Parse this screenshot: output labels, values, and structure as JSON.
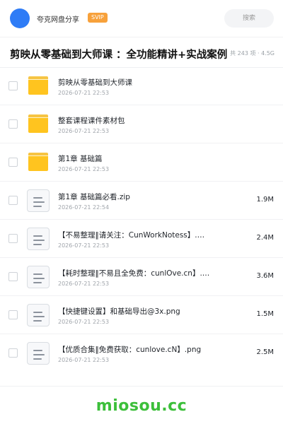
{
  "header": {
    "user_name": "夸克网盘分享",
    "badge": "SVIP",
    "search_label": "搜索"
  },
  "share": {
    "title": "剪映从零基础到大师课 ：全功能精讲+实战案例",
    "meta": "共 243 项 · 4.5G"
  },
  "files": [
    {
      "type": "folder",
      "name": "剪映从零基础到大师课",
      "date": "2026-07-21 22:53",
      "size": ""
    },
    {
      "type": "folder",
      "name": "整套课程课件素材包",
      "date": "2026-07-21 22:53",
      "size": ""
    },
    {
      "type": "folder",
      "name": "第1章 基础篇",
      "date": "2026-07-21 22:53",
      "size": ""
    },
    {
      "type": "file",
      "name": "第1章 基础篇必看.zip",
      "date": "2026-07-21 22:54",
      "size": "1.9M"
    },
    {
      "type": "file",
      "name": "【不易整理‖请关注：CunWorkNotess】.…",
      "date": "2026-07-21 22:53",
      "size": "2.4M"
    },
    {
      "type": "file",
      "name": "【耗时整理‖不易且全免费：cunlOve.cn】.…",
      "date": "2026-07-21 22:53",
      "size": "3.6M"
    },
    {
      "type": "file",
      "name": "【快捷键设置】和基础导出@3x.png",
      "date": "2026-07-21 22:53",
      "size": "1.5M"
    },
    {
      "type": "file",
      "name": "【优质合集‖免费获取：cunlove.cN】.png",
      "date": "2026-07-21 22:53",
      "size": "2.5M"
    }
  ],
  "footer": {
    "watermark": "miosou.cc"
  },
  "colors": {
    "accent": "#2f7cf6",
    "folder": "#ffc41f",
    "svip": "#f7a13b",
    "watermark": "#3cbf3a"
  }
}
